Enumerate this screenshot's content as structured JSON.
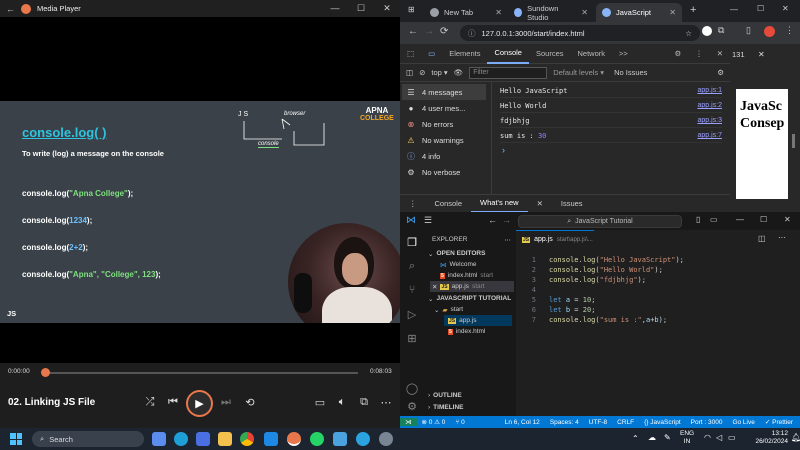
{
  "media_player": {
    "title": "Media Player",
    "window_buttons": [
      "—",
      "☐",
      "✕"
    ],
    "slide": {
      "heading": "console.log( )",
      "subtitle": "To write (log) a message on the console",
      "brand_top": "APNA",
      "brand_bottom": "COLLEGE",
      "corner_label": "JS",
      "sketch_js": "J S",
      "sketch_browser": "browser",
      "sketch_console": "console",
      "lines": [
        {
          "pre": "console.log(",
          "arg": "\"Apna College\"",
          "post": ");",
          "kind": "str"
        },
        {
          "pre": "console.log(",
          "arg": "1234",
          "post": ");",
          "kind": "num"
        },
        {
          "pre": "console.log(",
          "arg": "2+2",
          "post": ");",
          "kind": "num"
        },
        {
          "pre": "console.log(",
          "arg": "\"Apna\", \"College\", 123",
          "post": ");",
          "kind": "mixed"
        }
      ]
    },
    "time_current": "0:00:00",
    "time_total": "0:08:03",
    "progress_fraction": 0.0,
    "track_title": "02. Linking JS File"
  },
  "chrome": {
    "tabs": [
      {
        "label": "New Tab",
        "favicon_color": "#9aa0a6",
        "active": false
      },
      {
        "label": "Sundown Studio",
        "favicon_color": "#8ab4f8",
        "active": false
      },
      {
        "label": "JavaScript",
        "favicon_color": "#8ab4f8",
        "active": true
      }
    ],
    "new_tab": "+",
    "url": "127.0.0.1:3000/start/index.html",
    "devtools": {
      "tabs": [
        "Elements",
        "Console",
        "Sources",
        "Network",
        ">>"
      ],
      "active_tab": "Console",
      "issue_count": "131",
      "context": "top ▾",
      "filter_placeholder": "Filter",
      "levels": "Default levels ▾",
      "issues": "No Issues",
      "sidebar": [
        {
          "icon": "list-icon",
          "glyph": "☰",
          "label": "4 messages",
          "color": "#ddd"
        },
        {
          "icon": "user-icon",
          "glyph": "●",
          "label": "4 user mes...",
          "color": "#ddd"
        },
        {
          "icon": "error-icon",
          "glyph": "⊗",
          "label": "No errors",
          "color": "#f28b82"
        },
        {
          "icon": "warning-icon",
          "glyph": "⚠",
          "label": "No warnings",
          "color": "#fdd663"
        },
        {
          "icon": "info-icon",
          "glyph": "ⓘ",
          "label": "4 info",
          "color": "#8ab4f8"
        },
        {
          "icon": "verbose-icon",
          "glyph": "⚙",
          "label": "No verbose",
          "color": "#ddd"
        }
      ],
      "logs": [
        {
          "text": "Hello JavaScript",
          "source": "app.js:1"
        },
        {
          "text": "Hello World",
          "source": "app.js:2"
        },
        {
          "text": "fdjbhjg",
          "source": "app.js:3"
        },
        {
          "text_pre": "sum is : ",
          "text_num": "30",
          "source": "app.js:7"
        }
      ],
      "prompt": "›",
      "drawer_tabs": [
        "Console",
        "What's new",
        "Issues"
      ],
      "drawer_active": "What's new"
    },
    "page_preview_line1": "JavaSc",
    "page_preview_line2": "Consep"
  },
  "vscode": {
    "command_center": "JavaScript Tutorial",
    "explorer_title": "EXPLORER",
    "open_editors": "OPEN EDITORS",
    "open_files": [
      {
        "name": "Welcome",
        "type": "welcome",
        "hint": ""
      },
      {
        "name": "index.html",
        "type": "html",
        "hint": "start"
      },
      {
        "name": "app.js",
        "type": "js",
        "hint": "start"
      }
    ],
    "project": "JAVASCRIPT TUTORIAL",
    "folder": "start",
    "files": [
      {
        "name": "app.js",
        "type": "js"
      },
      {
        "name": "index.html",
        "type": "html"
      }
    ],
    "outline": "OUTLINE",
    "timeline": "TIMELINE",
    "editor_tab": "app.js",
    "editor_tab_path": "start\\app.js\\...",
    "code_lines": [
      {
        "n": "1",
        "parts": [
          [
            "f",
            "console"
          ],
          [
            "d",
            "."
          ],
          [
            "f",
            "log"
          ],
          [
            "d",
            "("
          ],
          [
            "s",
            "\"Hello JavaScript\""
          ],
          [
            "d",
            ");"
          ]
        ]
      },
      {
        "n": "2",
        "parts": [
          [
            "f",
            "console"
          ],
          [
            "d",
            "."
          ],
          [
            "f",
            "log"
          ],
          [
            "d",
            "("
          ],
          [
            "s",
            "\"Hello World\""
          ],
          [
            "d",
            ");"
          ]
        ]
      },
      {
        "n": "3",
        "parts": [
          [
            "f",
            "console"
          ],
          [
            "d",
            "."
          ],
          [
            "f",
            "log"
          ],
          [
            "d",
            "("
          ],
          [
            "s",
            "\"fdjbhjg\""
          ],
          [
            "d",
            ");"
          ]
        ]
      },
      {
        "n": "4",
        "parts": []
      },
      {
        "n": "5",
        "parts": [
          [
            "k",
            "let"
          ],
          [
            "d",
            " "
          ],
          [
            "v",
            "a"
          ],
          [
            "d",
            " = "
          ],
          [
            "n",
            "10"
          ],
          [
            "d",
            ";"
          ]
        ]
      },
      {
        "n": "6",
        "parts": [
          [
            "k",
            "let"
          ],
          [
            "d",
            " "
          ],
          [
            "v",
            "b"
          ],
          [
            "d",
            " = "
          ],
          [
            "n",
            "20"
          ],
          [
            "d",
            ";"
          ]
        ]
      },
      {
        "n": "7",
        "parts": [
          [
            "f",
            "console"
          ],
          [
            "d",
            "."
          ],
          [
            "f",
            "log"
          ],
          [
            "d",
            "("
          ],
          [
            "s",
            "\"sum is :\""
          ],
          [
            "d",
            ","
          ],
          [
            "v",
            "a"
          ],
          [
            "d",
            "+"
          ],
          [
            "v",
            "b"
          ],
          [
            "d",
            ");"
          ]
        ]
      }
    ],
    "status": {
      "remote": "⋊",
      "problems": "⊗ 0 ⚠ 0",
      "ports": "⑂ 0",
      "position": "Ln 6, Col 12",
      "spaces": "Spaces: 4",
      "encoding": "UTF-8",
      "eol": "CRLF",
      "language": "{} JavaScript",
      "port": "Port : 3000",
      "go_live": "Go Live",
      "prettier": "✓ Prettier"
    }
  },
  "taskbar": {
    "search": "Search",
    "lang_top": "ENG",
    "lang_bottom": "IN",
    "time": "13:12",
    "date": "26/02/2024"
  }
}
